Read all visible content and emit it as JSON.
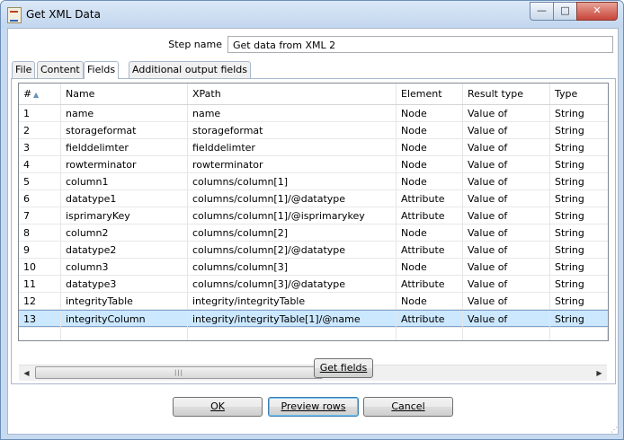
{
  "window": {
    "title": "Get XML Data",
    "minimize_glyph": "—",
    "maximize_glyph": "□",
    "close_glyph": "✕"
  },
  "step": {
    "label": "Step name",
    "value": "Get data from XML 2"
  },
  "tabs": [
    "File",
    "Content",
    "Fields",
    "Additional output fields"
  ],
  "active_tab": "Fields",
  "table": {
    "columns": [
      "#",
      "Name",
      "XPath",
      "Element",
      "Result type",
      "Type"
    ],
    "rows": [
      [
        "1",
        "name",
        "name",
        "Node",
        "Value of",
        "String"
      ],
      [
        "2",
        "storageformat",
        "storageformat",
        "Node",
        "Value of",
        "String"
      ],
      [
        "3",
        "fielddelimter",
        "fielddelimter",
        "Node",
        "Value of",
        "String"
      ],
      [
        "4",
        "rowterminator",
        "rowterminator",
        "Node",
        "Value of",
        "String"
      ],
      [
        "5",
        "column1",
        "columns/column[1]",
        "Node",
        "Value of",
        "String"
      ],
      [
        "6",
        "datatype1",
        "columns/column[1]/@datatype",
        "Attribute",
        "Value of",
        "String"
      ],
      [
        "7",
        "isprimaryKey",
        "columns/column[1]/@isprimarykey",
        "Attribute",
        "Value of",
        "String"
      ],
      [
        "8",
        "column2",
        "columns/column[2]",
        "Node",
        "Value of",
        "String"
      ],
      [
        "9",
        "datatype2",
        "columns/column[2]/@datatype",
        "Attribute",
        "Value of",
        "String"
      ],
      [
        "10",
        "column3",
        "columns/column[3]",
        "Node",
        "Value of",
        "String"
      ],
      [
        "11",
        "datatype3",
        "columns/column[3]/@datatype",
        "Attribute",
        "Value of",
        "String"
      ],
      [
        "12",
        "integrityTable",
        "integrity/integrityTable",
        "Node",
        "Value of",
        "String"
      ],
      [
        "13",
        "integrityColumn",
        "integrity/integrityTable[1]/@name",
        "Attribute",
        "Value of",
        "String"
      ]
    ],
    "selected_row": "13"
  },
  "buttons": {
    "get_fields": "Get fields",
    "ok": "OK",
    "preview": "Preview rows",
    "cancel": "Cancel"
  },
  "colors": {
    "selection": "#cce8ff",
    "frame": "#c7daf0"
  }
}
